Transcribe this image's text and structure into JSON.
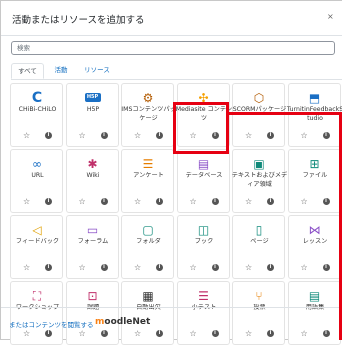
{
  "dialog": {
    "title": "活動またはリソースを追加する",
    "close_glyph": "×"
  },
  "search": {
    "placeholder": "検索"
  },
  "tabs": [
    {
      "label": "すべて",
      "active": true
    },
    {
      "label": "活動",
      "active": false
    },
    {
      "label": "リソース",
      "active": false
    }
  ],
  "items": [
    {
      "label": "CHiBi-CHiLO",
      "icon": "chilo-c-icon",
      "color": "#1a6fc4"
    },
    {
      "label": "H5P",
      "icon": "h5p-icon",
      "color": "#1a6fc4"
    },
    {
      "label": "IMSコンテンツパッケージ",
      "icon": "ims-package-icon",
      "color": "#b25a00"
    },
    {
      "label": "Mediasite コンテンツ",
      "icon": "mediasite-icon",
      "color": "#f5a000"
    },
    {
      "label": "SCORMパッケージ",
      "icon": "scorm-icon",
      "color": "#b25a00"
    },
    {
      "label": "TurnitinFeedbackStudio",
      "icon": "turnitin-icon",
      "color": "#1a6fc4"
    },
    {
      "label": "URL",
      "icon": "link-icon",
      "color": "#1a6fc4"
    },
    {
      "label": "Wiki",
      "icon": "wiki-icon",
      "color": "#c0306a"
    },
    {
      "label": "アンケート",
      "icon": "survey-icon",
      "color": "#e67e00"
    },
    {
      "label": "データベース",
      "icon": "database-icon",
      "color": "#8a4fc7"
    },
    {
      "label": "テキストおよびメディア領域",
      "icon": "text-media-icon",
      "color": "#0f8a7a"
    },
    {
      "label": "ファイル",
      "icon": "file-icon",
      "color": "#0f8a7a"
    },
    {
      "label": "フィードバック",
      "icon": "feedback-icon",
      "color": "#e0a000"
    },
    {
      "label": "フォーラム",
      "icon": "forum-icon",
      "color": "#8a4fc7"
    },
    {
      "label": "フォルダ",
      "icon": "folder-icon",
      "color": "#0f8a7a"
    },
    {
      "label": "ブック",
      "icon": "book-icon",
      "color": "#0f8a7a"
    },
    {
      "label": "ページ",
      "icon": "page-icon",
      "color": "#0f8a7a"
    },
    {
      "label": "レッスン",
      "icon": "lesson-icon",
      "color": "#8a4fc7"
    },
    {
      "label": "ワークショップ",
      "icon": "workshop-icon",
      "color": "#c0306a"
    },
    {
      "label": "課題",
      "icon": "assignment-icon",
      "color": "#c0306a"
    },
    {
      "label": "自動出欠",
      "icon": "attendance-icon",
      "color": "#333333"
    },
    {
      "label": "小テスト",
      "icon": "quiz-icon",
      "color": "#c0306a"
    },
    {
      "label": "投票",
      "icon": "choice-icon",
      "color": "#e67e00"
    },
    {
      "label": "用語集",
      "icon": "glossary-icon",
      "color": "#0f8a7a"
    }
  ],
  "star_glyph": "☆",
  "info_glyph": "i",
  "footer": {
    "link_text": "またはコンテンツを閲覧する",
    "brand_m": "m",
    "brand_rest": "oodleNet"
  },
  "annotation": {
    "color": "#e60012"
  }
}
